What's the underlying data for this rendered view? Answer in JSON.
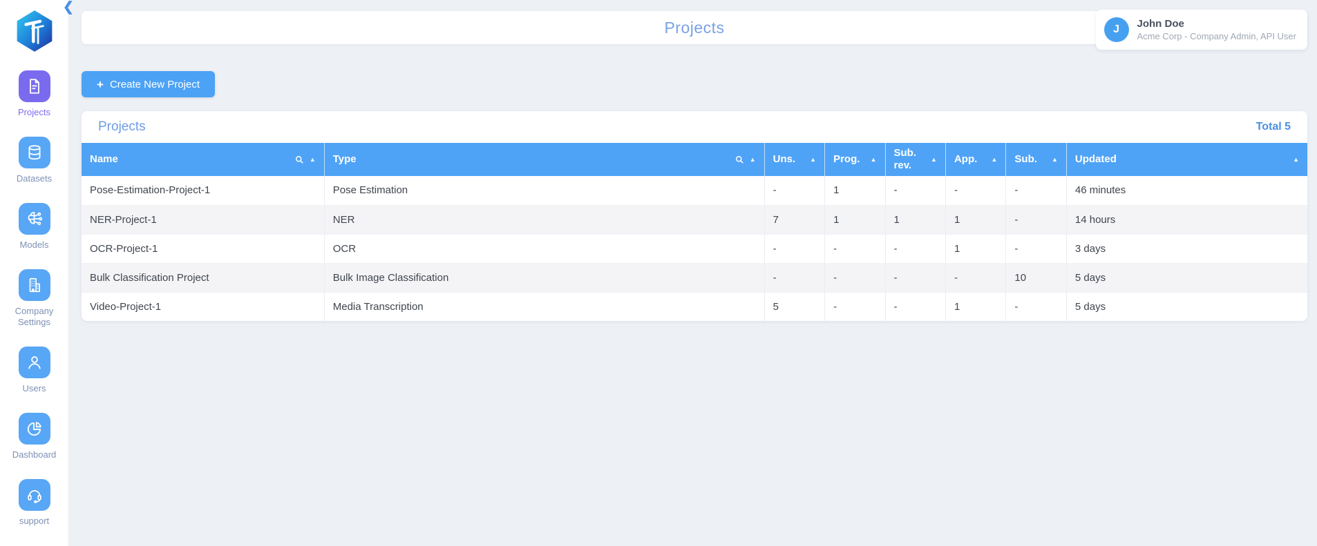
{
  "app": {
    "collapse_icon": "❮",
    "colors": {
      "accent_blue": "#4FA3F6",
      "icon_blue": "#58A6F6",
      "active_purple": "#7A6BEE",
      "title_blue": "#79A1E6",
      "total_blue": "#4A90E2",
      "page_background": "#EDF0F5",
      "stripe_row": "#F4F4F7",
      "body_text": "#3F454D",
      "sidebar_label": "#7E90B5"
    }
  },
  "sidebar": {
    "logo_icon": "hexagon-logo-icon",
    "items": [
      {
        "label": "Projects",
        "icon": "document-icon",
        "active": true
      },
      {
        "label": "Datasets",
        "icon": "database-icon",
        "active": false
      },
      {
        "label": "Models",
        "icon": "brain-icon",
        "active": false
      },
      {
        "label": "Company Settings",
        "icon": "building-icon",
        "active": false
      },
      {
        "label": "Users",
        "icon": "user-icon",
        "active": false
      },
      {
        "label": "Dashboard",
        "icon": "pie-chart-icon",
        "active": false
      },
      {
        "label": "support",
        "icon": "headset-icon",
        "active": false
      }
    ]
  },
  "header": {
    "title": "Projects",
    "user": {
      "initial": "J",
      "name": "John Doe",
      "subtitle": "Acme Corp - Company Admin, API User"
    }
  },
  "toolbar": {
    "plus": "+",
    "create_button_label": "Create New Project"
  },
  "table_card": {
    "title": "Projects",
    "total_label": "Total 5",
    "sort_icon": "sort-asc-icon",
    "columns": [
      {
        "label": "Name",
        "search_icon": "search-icon",
        "sort": "▲"
      },
      {
        "label": "Type",
        "search_icon": "search-icon",
        "sort": "▲"
      },
      {
        "label": "Uns.",
        "sort": "▲"
      },
      {
        "label": "Prog.",
        "sort": "▲"
      },
      {
        "label": "Sub. rev.",
        "sort": "▲"
      },
      {
        "label": "App.",
        "sort": "▲"
      },
      {
        "label": "Sub.",
        "sort": "▲"
      },
      {
        "label": "Updated",
        "sort": "▲"
      }
    ],
    "rows": [
      {
        "name": "Pose-Estimation-Project-1",
        "type": "Pose Estimation",
        "uns": "-",
        "prog": "1",
        "sub_rev": "-",
        "app": "-",
        "sub": "-",
        "updated": "46 minutes"
      },
      {
        "name": "NER-Project-1",
        "type": "NER",
        "uns": "7",
        "prog": "1",
        "sub_rev": "1",
        "app": "1",
        "sub": "-",
        "updated": "14 hours"
      },
      {
        "name": "OCR-Project-1",
        "type": "OCR",
        "uns": "-",
        "prog": "-",
        "sub_rev": "-",
        "app": "1",
        "sub": "-",
        "updated": "3 days"
      },
      {
        "name": "Bulk Classification Project",
        "type": "Bulk Image Classification",
        "uns": "-",
        "prog": "-",
        "sub_rev": "-",
        "app": "-",
        "sub": "10",
        "updated": "5 days"
      },
      {
        "name": "Video-Project-1",
        "type": "Media Transcription",
        "uns": "5",
        "prog": "-",
        "sub_rev": "-",
        "app": "1",
        "sub": "-",
        "updated": "5 days"
      }
    ]
  }
}
